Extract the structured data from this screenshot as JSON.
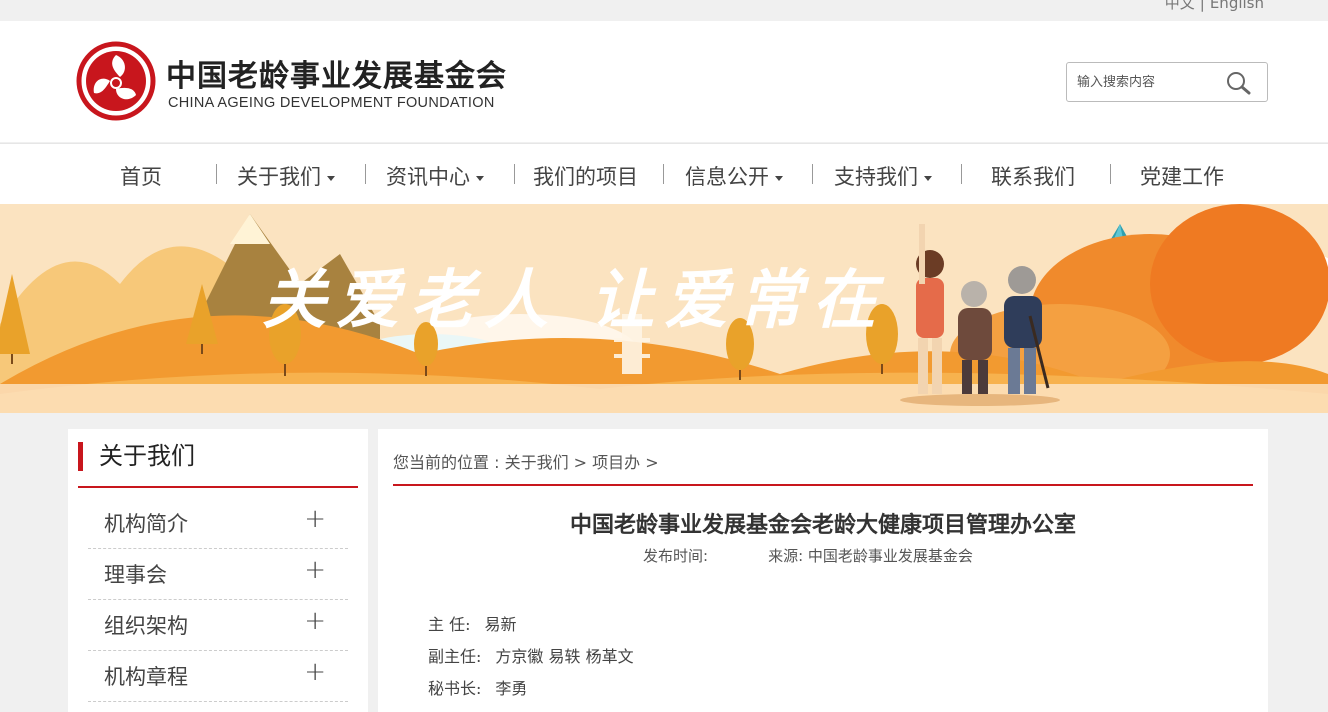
{
  "lang": {
    "zh": "中文",
    "separator": "|",
    "en": "English"
  },
  "header": {
    "title_cn": "中国老龄事业发展基金会",
    "title_en": "CHINA AGEING DEVELOPMENT FOUNDATION"
  },
  "search": {
    "placeholder": "输入搜索内容",
    "icon": "search-icon"
  },
  "nav": [
    {
      "label": "首页",
      "has_dropdown": false
    },
    {
      "label": "关于我们",
      "has_dropdown": true
    },
    {
      "label": "资讯中心",
      "has_dropdown": true
    },
    {
      "label": "我们的项目",
      "has_dropdown": false
    },
    {
      "label": "信息公开",
      "has_dropdown": true
    },
    {
      "label": "支持我们",
      "has_dropdown": true
    },
    {
      "label": "联系我们",
      "has_dropdown": false
    },
    {
      "label": "党建工作",
      "has_dropdown": false
    }
  ],
  "banner": {
    "slogan": "关爱老人  让爱常在"
  },
  "sidebar": {
    "title": "关于我们",
    "items": [
      {
        "label": "机构简介",
        "expand": "+"
      },
      {
        "label": "理事会",
        "expand": "+"
      },
      {
        "label": "组织架构",
        "expand": "+"
      },
      {
        "label": "机构章程",
        "expand": "+"
      }
    ]
  },
  "breadcrumb": {
    "text": "您当前的位置 : 关于我们 > 项目办 >"
  },
  "article": {
    "title": "中国老龄事业发展基金会老龄大健康项目管理办公室",
    "publish_label": "发布时间:",
    "source_label": "来源: 中国老龄事业发展基金会",
    "staff": [
      {
        "role": "主  任:",
        "names": "易新"
      },
      {
        "role": "副主任:",
        "names": "方京徽  易轶  杨革文"
      },
      {
        "role": "秘书长:",
        "names": "李勇"
      }
    ]
  },
  "colors": {
    "accent": "#c8161d",
    "banner_sky": "#fbe3c0",
    "banner_orange": "#f2a33a"
  }
}
